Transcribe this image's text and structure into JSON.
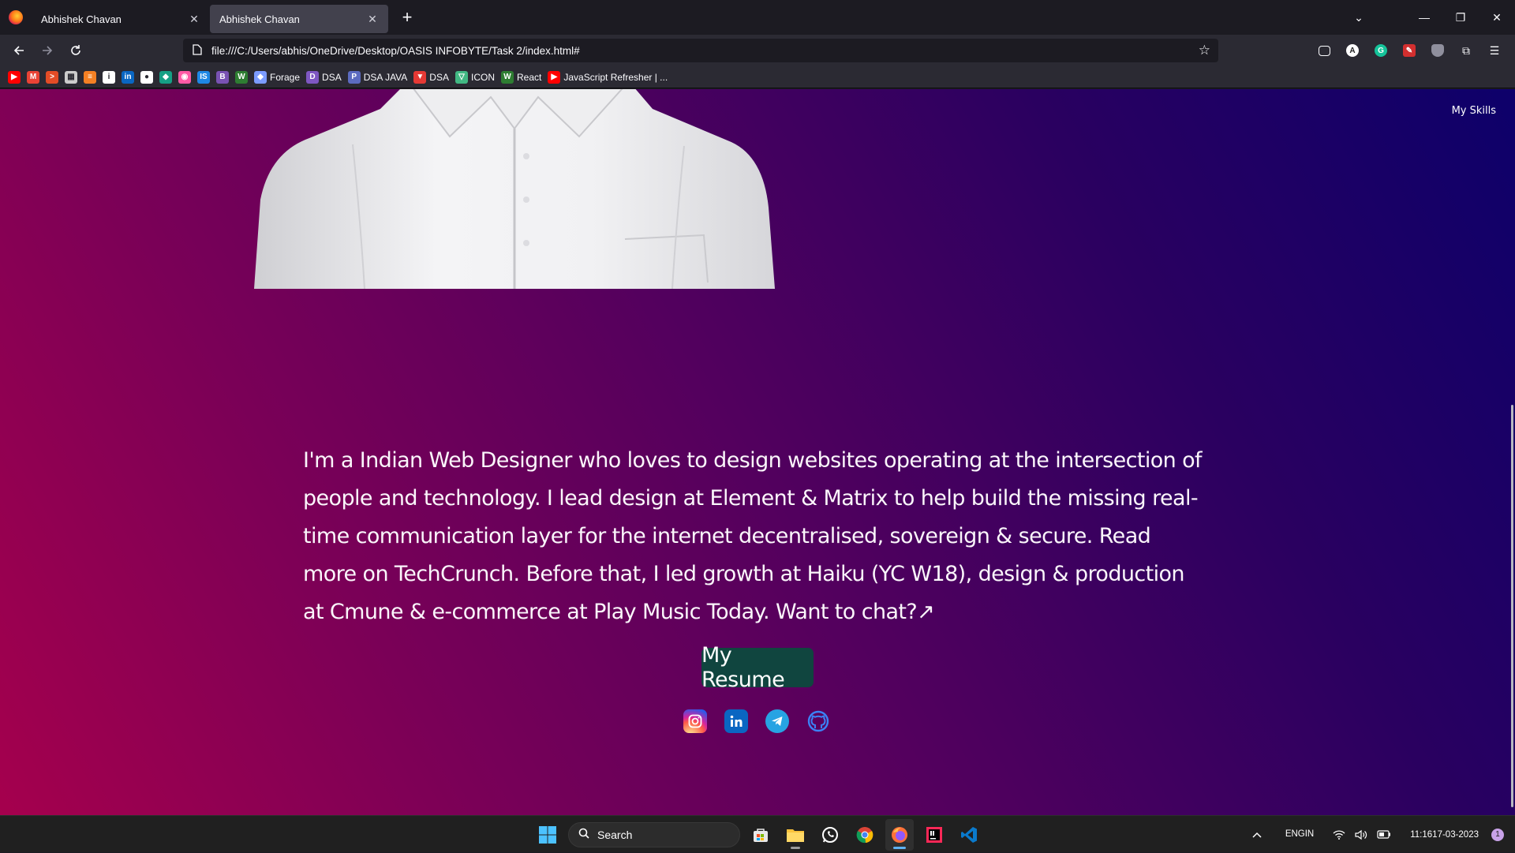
{
  "browser": {
    "tabs": [
      {
        "title": "Abhishek Chavan",
        "active": false
      },
      {
        "title": "Abhishek Chavan",
        "active": true
      }
    ],
    "url": "file:///C:/Users/abhis/OneDrive/Desktop/OASIS INFOBYTE/Task 2/index.html#",
    "bookmarks": [
      {
        "label": "",
        "icon": "youtube-icon",
        "color": "#ff0000"
      },
      {
        "label": "",
        "icon": "gmail-icon",
        "color": "#ea4335"
      },
      {
        "label": "",
        "icon": "terminal-icon",
        "color": "#e34c26"
      },
      {
        "label": "",
        "icon": "grid-icon",
        "color": "#cccccc"
      },
      {
        "label": "",
        "icon": "stack-icon",
        "color": "#f48024"
      },
      {
        "label": "",
        "icon": "info-icon",
        "color": "#ffffff"
      },
      {
        "label": "",
        "icon": "linkedin-icon",
        "color": "#0a66c2"
      },
      {
        "label": "",
        "icon": "github-icon",
        "color": "#ffffff"
      },
      {
        "label": "",
        "icon": "diamond-icon",
        "color": "#16a085"
      },
      {
        "label": "",
        "icon": "eye-icon",
        "color": "#ff5aa5"
      },
      {
        "label": "",
        "icon": "is-icon",
        "color": "#1e88e5"
      },
      {
        "label": "",
        "icon": "bootstrap-icon",
        "color": "#7952b3"
      },
      {
        "label": "",
        "icon": "w-icon",
        "color": "#2e7d32"
      },
      {
        "label": "Forage",
        "icon": "forage-icon",
        "color": "#7b9bff"
      },
      {
        "label": "DSA",
        "icon": "dsa-icon",
        "color": "#7e57c2"
      },
      {
        "label": "DSA JAVA",
        "icon": "dsa-java-icon",
        "color": "#5c6bc0"
      },
      {
        "label": "DSA",
        "icon": "dsa-red-icon",
        "color": "#e53935"
      },
      {
        "label": "ICON",
        "icon": "vue-icon",
        "color": "#41b883"
      },
      {
        "label": "React",
        "icon": "w-react-icon",
        "color": "#2e7d32"
      },
      {
        "label": "JavaScript Refresher | ...",
        "icon": "youtube-icon",
        "color": "#ff0000"
      }
    ]
  },
  "page": {
    "nav_link": "My Skills",
    "bio": "I'm a Indian Web Designer who loves to design websites operating at the intersection of people and technology. I lead design at Element & Matrix to help build the missing real-time communication layer for the internet decentralised, sovereign & secure. Read more on TechCrunch. Before that, I led growth at Haiku (YC W18), design & production at Cmune & e-commerce at Play Music Today. Want to chat?↗",
    "resume_button": "My Resume",
    "socials": [
      {
        "name": "instagram-icon"
      },
      {
        "name": "linkedin-icon"
      },
      {
        "name": "telegram-icon"
      },
      {
        "name": "github-icon"
      }
    ],
    "colors": {
      "resume_bg": "#10453f",
      "gradient_start": "#a5004d",
      "gradient_end": "#0d006a"
    }
  },
  "taskbar": {
    "search_label": "Search",
    "lang_top": "ENG",
    "lang_bottom": "IN",
    "time": "11:16",
    "date": "17-03-2023",
    "notifications": "1"
  }
}
